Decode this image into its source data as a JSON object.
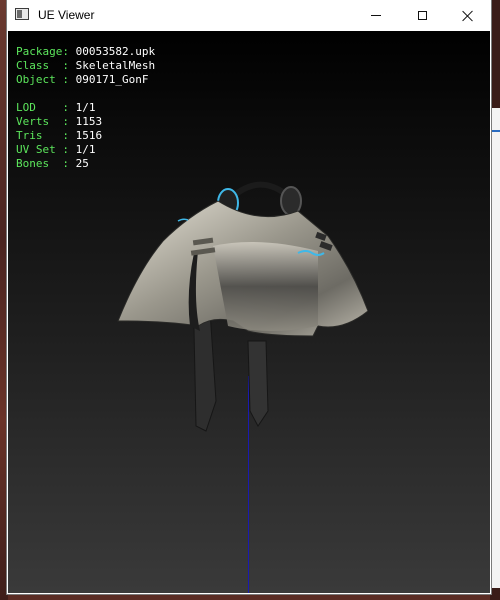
{
  "window": {
    "title": "UE Viewer"
  },
  "info_panel": {
    "rows_top": [
      {
        "label": "Package: ",
        "value": "00053582.upk"
      },
      {
        "label": "Class  : ",
        "value": "SkeletalMesh"
      },
      {
        "label": "Object : ",
        "value": "090171_GonF"
      }
    ],
    "rows_bottom": [
      {
        "label": "LOD    : ",
        "value": "1/1"
      },
      {
        "label": "Verts  : ",
        "value": "1153"
      },
      {
        "label": "Tris   : ",
        "value": "1516"
      },
      {
        "label": "UV Set : ",
        "value": "1/1"
      },
      {
        "label": "Bones  : ",
        "value": "25"
      }
    ]
  },
  "colors": {
    "label": "#5ce65c",
    "value": "#ffffff",
    "axis": "#1a1ab0",
    "accent_glow": "#3fb8e8"
  },
  "icons": [
    "app-window-icon",
    "minimize-icon",
    "maximize-icon",
    "close-icon"
  ]
}
